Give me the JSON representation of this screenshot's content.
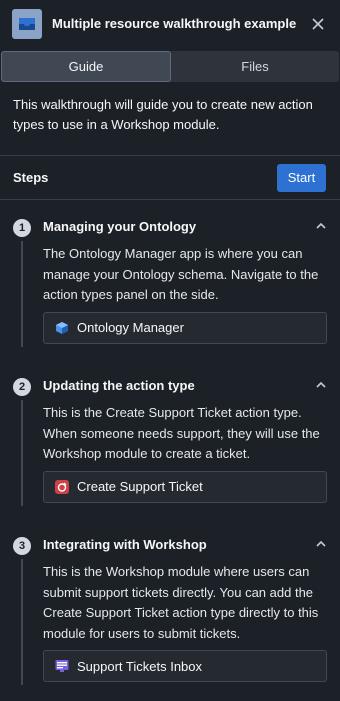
{
  "header": {
    "title": "Multiple resource walkthrough example",
    "app_icon": "tray-icon",
    "close_icon": "close-icon"
  },
  "tabs": [
    {
      "label": "Guide",
      "active": true
    },
    {
      "label": "Files",
      "active": false
    }
  ],
  "intro": "This walkthrough will guide you to create new action types to use in a Workshop module.",
  "steps_section": {
    "label": "Steps",
    "start_label": "Start"
  },
  "steps": [
    {
      "number": "1",
      "title": "Managing your Ontology",
      "description": "The Ontology Manager app is where you can manage your Ontology schema. Navigate to the action types panel on the side.",
      "resource": {
        "label": "Ontology Manager",
        "icon": "cube-icon"
      }
    },
    {
      "number": "2",
      "title": "Updating the action type",
      "description": "This is the Create Support Ticket action type. When someone needs support, they will use the Workshop module to create a ticket.",
      "resource": {
        "label": "Create Support Ticket",
        "icon": "action-icon"
      }
    },
    {
      "number": "3",
      "title": "Integrating with Workshop",
      "description": "This is the Workshop module where users can submit support tickets directly. You can add the Create Support Ticket action type directly to this module for users to submit tickets.",
      "resource": {
        "label": "Support Tickets Inbox",
        "icon": "workshop-icon"
      }
    }
  ],
  "colors": {
    "background": "#1c2127",
    "accent": "#2d72d2",
    "app_icon_bg": "#8aa3c7"
  }
}
